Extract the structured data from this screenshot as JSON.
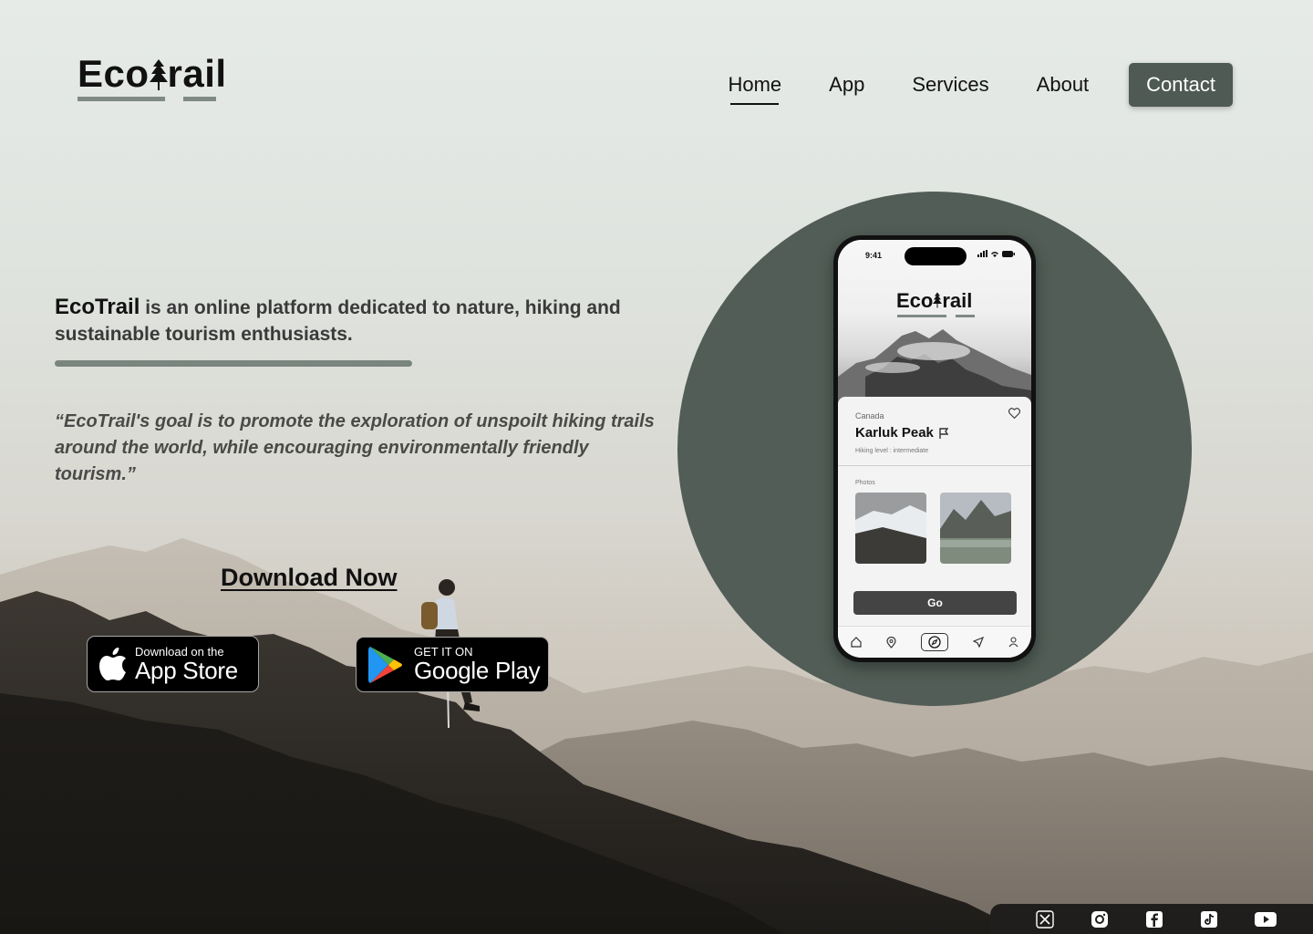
{
  "brand": {
    "logo_prefix": "Eco",
    "logo_suffix": "rail"
  },
  "nav": {
    "items": [
      {
        "label": "Home",
        "active": true
      },
      {
        "label": "App"
      },
      {
        "label": "Services"
      },
      {
        "label": "About"
      }
    ],
    "contact_label": "Contact"
  },
  "hero": {
    "brand_name": "EcoTrail",
    "intro_rest": " is an online platform dedicated to nature, hiking and sustainable tourism enthusiasts.",
    "quote": "“EcoTrail's goal is to promote the exploration of unspoilt hiking trails around the world, while encouraging environmentally friendly tourism.”",
    "download_label": "Download Now"
  },
  "badges": {
    "apple_small": "Download on the",
    "apple_big": "App Store",
    "google_small": "GET IT ON",
    "google_big": "Google Play"
  },
  "phone": {
    "time": "9:41",
    "logo_prefix": "Eco",
    "logo_suffix": "rail",
    "country": "Canada",
    "peak_name": "Karluk Peak",
    "level": "Hiking level : intermediate",
    "photos_label": "Photos",
    "go_label": "Go",
    "tabs": [
      "home-icon",
      "map-pin-icon",
      "compass-icon",
      "send-icon",
      "user-icon"
    ]
  },
  "social": [
    "x-icon",
    "instagram-icon",
    "facebook-icon",
    "tiktok-icon",
    "youtube-icon"
  ],
  "colors": {
    "accent": "#4f5a54",
    "circle": "#515d56",
    "bar": "#7a857f"
  }
}
